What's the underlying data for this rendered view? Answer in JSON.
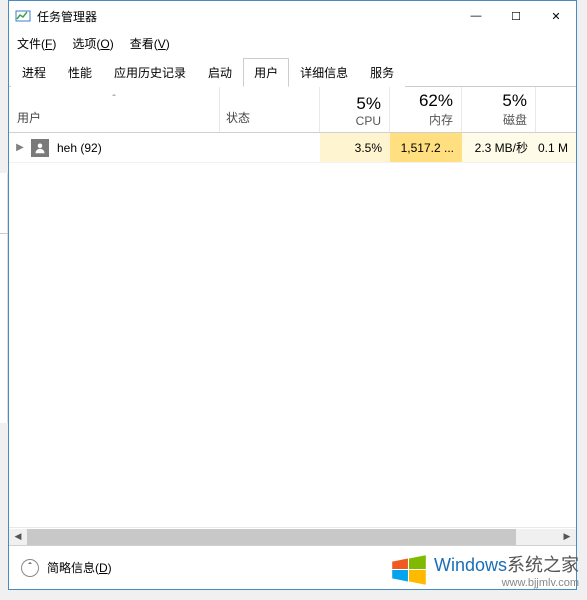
{
  "window": {
    "title": "任务管理器",
    "minimize": "—",
    "maximize": "☐",
    "close": "✕"
  },
  "menu": {
    "file": "文件(F)",
    "options": "选项(O)",
    "view": "查看(V)"
  },
  "tabs": {
    "processes": "进程",
    "performance": "性能",
    "apphistory": "应用历史记录",
    "startup": "启动",
    "users": "用户",
    "details": "详细信息",
    "services": "服务"
  },
  "headers": {
    "sort": "ˆ",
    "name": "用户",
    "status": "状态",
    "cpu_pct": "5%",
    "cpu_lbl": "CPU",
    "mem_pct": "62%",
    "mem_lbl": "内存",
    "disk_pct": "5%",
    "disk_lbl": "磁盘"
  },
  "row": {
    "expand": "▶",
    "user": "heh (92)",
    "status": "",
    "cpu": "3.5%",
    "mem": "1,517.2 ...",
    "disk": "2.3 MB/秒",
    "net": "0.1 M"
  },
  "footer": {
    "chevron": "ˆ",
    "brief": "简略信息(D)"
  },
  "watermark": {
    "brand": "Windows",
    "suffix": "系统之家",
    "url": "www.bjjmlv.com"
  }
}
